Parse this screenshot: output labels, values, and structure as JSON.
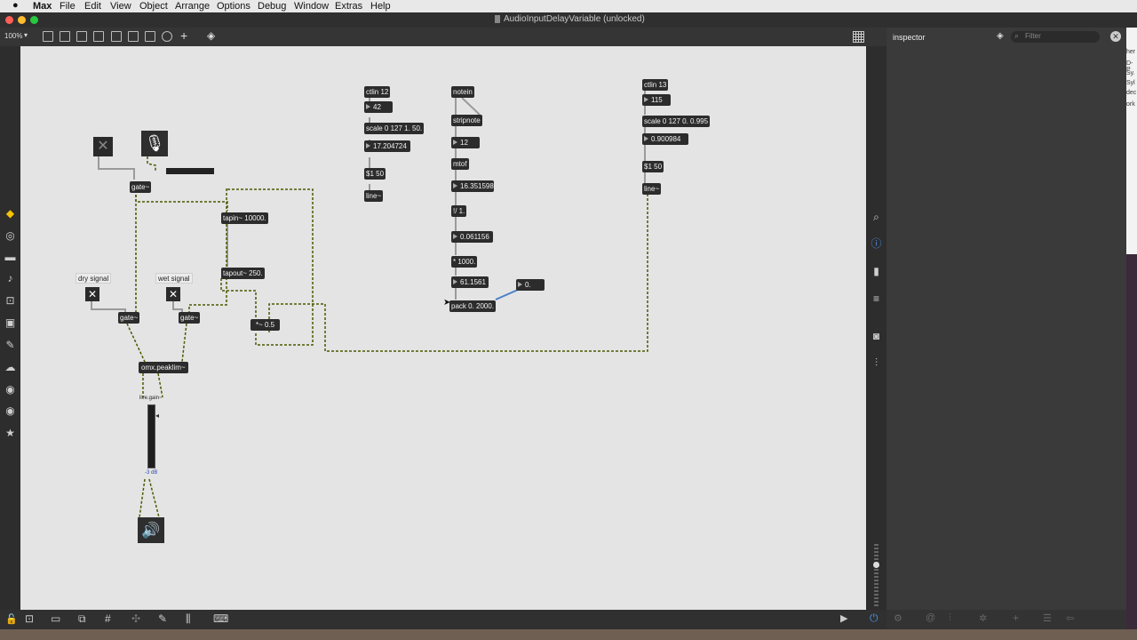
{
  "menubar": {
    "apple": "",
    "items": [
      "Max",
      "File",
      "Edit",
      "View",
      "Object",
      "Arrange",
      "Options",
      "Debug",
      "Window",
      "Extras",
      "Help"
    ]
  },
  "window": {
    "title": "AudioInputDelayVariable (unlocked)"
  },
  "toolbar": {
    "zoom": "100%"
  },
  "inspector": {
    "title": "inspector",
    "filter_placeholder": "Filter"
  },
  "side_strip_text": [
    "her",
    "D-P",
    "Sy.",
    "Syl",
    "dec",
    "ork"
  ],
  "patch": {
    "objects": {
      "ctlin12": "ctlin 12",
      "num42": "42",
      "scale1": "scale 0 127 1. 50.",
      "num17": "17.204724",
      "msg1": "$1 50",
      "line1": "line~",
      "notein": "notein",
      "stripnote": "stripnote",
      "num12": "12",
      "mtof": "mtof",
      "num16": "16.351598",
      "div": "!/ 1.",
      "num006": "0.061156",
      "mult": "* 1000.",
      "num61": "61.1561",
      "num0": "0.",
      "pack": "pack 0. 2000.",
      "ctlin13": "ctlin 13",
      "num115": "115",
      "scale2": "scale 0 127 0. 0.995",
      "num09": "0.900984",
      "msg2": "$1 50",
      "line2": "line~",
      "gate_top": "gate~",
      "tapin": "tapin~ 10000.",
      "tapout": "tapout~ 250.",
      "mult05": "*~ 0.5",
      "dry_label": "dry signal",
      "wet_label": "wet signal",
      "gate_dry": "gate~",
      "gate_wet": "gate~",
      "peaklim": "omx.peaklim~",
      "livegain": "live.gain~",
      "gain_value": "-3 dB"
    }
  }
}
